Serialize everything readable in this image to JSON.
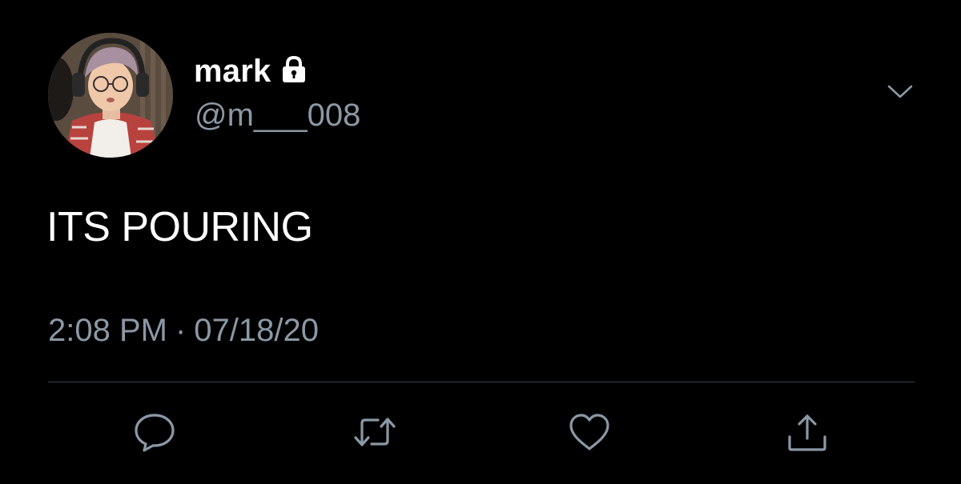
{
  "user": {
    "display_name": "mark",
    "handle": "@m___008",
    "protected_icon": "lock-icon",
    "avatar_icon": "profile-photo"
  },
  "tweet": {
    "text": "ITS POURING",
    "time": "2:08 PM",
    "separator": "·",
    "date": "07/18/20"
  },
  "actions": [
    {
      "name": "reply",
      "icon": "speech-bubble-icon"
    },
    {
      "name": "retweet",
      "icon": "retweet-arrows-icon"
    },
    {
      "name": "like",
      "icon": "heart-icon"
    },
    {
      "name": "share",
      "icon": "share-upload-icon"
    }
  ],
  "colors": {
    "background": "#000000",
    "primary_text": "#ffffff",
    "secondary_text": "#8b98a5",
    "divider": "#38444d"
  }
}
